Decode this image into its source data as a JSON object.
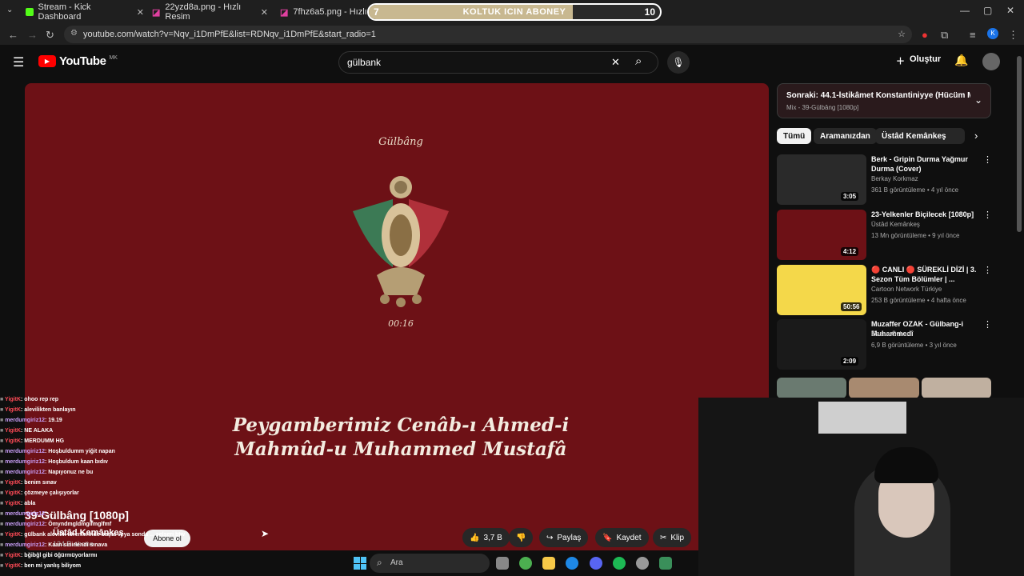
{
  "browser": {
    "tabs": [
      {
        "title": "Stream - Kick Dashboard",
        "icon": "kick-icon"
      },
      {
        "title": "22yzd8a.png - Hızlı Resim",
        "icon": "photo-icon"
      },
      {
        "title": "7fhz6a5.png - Hızlı Resim",
        "icon": "photo-icon"
      }
    ],
    "url": "youtube.com/watch?v=Nqv_i1DmPfE&list=RDNqv_i1DmPfE&start_radio=1"
  },
  "sub_goal": {
    "current": "7",
    "label": "KOLTUK ICIN ABONEY",
    "target": "10",
    "progress": 0.7
  },
  "youtube": {
    "logo_text": "YouTube",
    "region": "MK",
    "search_value": "gülbank",
    "create_label": "Oluştur"
  },
  "video": {
    "overlay_title": "Gülbâng",
    "timestamp": "00:16",
    "line1": "Peygamberimiz Cenâb-ı Ahmed-i",
    "line2": "Mahmûd-u Muhammed Mustafâ",
    "title": "39-Gülbâng [1080p]",
    "channel": "Üstâd Kemânkeş",
    "subscribers": "134 B abone",
    "subscribe_label": "Abone ol",
    "likes": "3,7 B",
    "share_label": "Paylaş",
    "save_label": "Kaydet",
    "clip_label": "Klip"
  },
  "up_next": {
    "title": "Sonraki: 44.1-İstikâmet Konstantiniyye (Hücüm Mar...",
    "subtitle": "Mix - 39-Gülbâng [1080p]"
  },
  "chips": [
    "Tümü",
    "Aramanızdan",
    "Üstâd Kemânkeş"
  ],
  "recommendations": [
    {
      "title": "Berk - Gripin Durma Yağmur Durma (Cover)",
      "channel": "Berkay Korkmaz",
      "meta": "361 B görüntüleme • 4 yıl önce",
      "duration": "3:05",
      "color": "#2a2a2a"
    },
    {
      "title": "23-Yelkenler Biçilecek [1080p]",
      "channel": "Üstâd Kemânkeş",
      "meta": "13 Mn görüntüleme • 9 yıl önce",
      "duration": "4:12",
      "color": "#6d1116"
    },
    {
      "title": "🔴 CANLI 🔴 SÜREKLİ DİZİ | 3. Sezon Tüm Bölümler | ...",
      "channel": "Cartoon Network Türkiye",
      "meta": "253 B görüntüleme • 4 hafta önce",
      "duration": "50:56",
      "color": "#f4d84a"
    },
    {
      "title": "Muzaffer OZAK - Gülbang-i Muhammedî",
      "channel": "Özcan Özhan",
      "meta": "6,9 B görüntüleme • 3 yıl önce",
      "duration": "2:09",
      "color": "#1a1a1a"
    }
  ],
  "chat": [
    {
      "user": "YigitK",
      "text": ": ohoo rep rep",
      "cls": "u"
    },
    {
      "user": "YigitK",
      "text": ": alevilikten banlayın",
      "cls": "u"
    },
    {
      "user": "merdumgiriz12",
      "text": ": 19.19",
      "cls": "u2"
    },
    {
      "user": "YigitK",
      "text": ": NE ALAKA",
      "cls": "u"
    },
    {
      "user": "YigitK",
      "text": ": MERDUMM HG",
      "cls": "u"
    },
    {
      "user": "merdumgiriz12",
      "text": ": Hoşbuldumm yiğit napan",
      "cls": "u2"
    },
    {
      "user": "merdumgiriz12",
      "text": ": Hoşbuldum kaan bıdıv",
      "cls": "u2"
    },
    {
      "user": "merdumgiriz12",
      "text": ": Napıyonuz ne bu",
      "cls": "u2"
    },
    {
      "user": "YigitK",
      "text": ": benim sınav",
      "cls": "u"
    },
    {
      "user": "YigitK",
      "text": ": çözmeye çalışıyorlar",
      "cls": "u"
    },
    {
      "user": "YigitK",
      "text": ": abla",
      "cls": "u"
    },
    {
      "user": "merdumgiriz12",
      "text": ": ...",
      "cls": "u2"
    },
    {
      "user": "merdumgiriz12",
      "text": ": Ömyndmgldmgifmglfmf",
      "cls": "u2"
    },
    {
      "user": "YigitK",
      "text": ": gülbank alevilik törenlerinde başta veya sonda ... selseri btw",
      "cls": "u"
    },
    {
      "user": "merdumgiriz12",
      "text": ": Kaan sinirlendi sınava",
      "cls": "u2"
    },
    {
      "user": "YigitK",
      "text": ": bğibğl gibi öğürmüyorlarmı",
      "cls": "u"
    },
    {
      "user": "YigitK",
      "text": ": ben mi yanlış biliyom",
      "cls": "u"
    }
  ],
  "taskbar": {
    "search_placeholder": "Ara"
  }
}
